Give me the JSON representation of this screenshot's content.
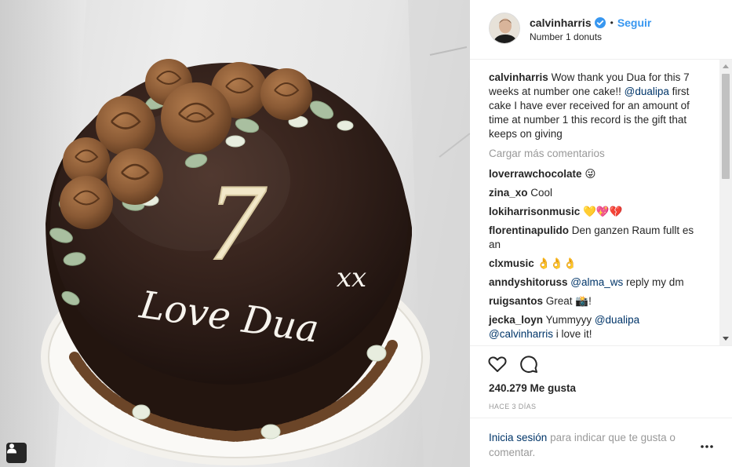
{
  "post": {
    "photo_alt": "Chocolate cake with seven piped chocolate roses, a large number 7 and the words Love Dua xx in white icing",
    "cake_text": {
      "number": "7",
      "message": "Love Dua",
      "kisses": "xx"
    }
  },
  "header": {
    "username": "calvinharris",
    "verified_icon": "verified-badge-icon",
    "separator": "•",
    "follow_label": "Seguir",
    "subtitle": "Number 1 donuts"
  },
  "caption": {
    "user": "calvinharris",
    "text_before": "Wow thank you Dua for this 7 weeks at number one cake!!",
    "mention": "@dualipa",
    "text_after": "first cake I have ever received for an amount of time at number 1 this record is the gift that keeps on giving"
  },
  "load_more_label": "Cargar más comentarios",
  "comments": [
    {
      "user": "loverrawchocolate",
      "text": "😜"
    },
    {
      "user": "zina_xo",
      "text": "Cool"
    },
    {
      "user": "lokiharrisonmusic",
      "text": "💛💖💔"
    },
    {
      "user": "florentinapulido",
      "text": "Den ganzen Raum fullt es an"
    },
    {
      "user": "clxmusic",
      "text": "👌👌👌"
    },
    {
      "user": "anndyshitoruss",
      "mention": "@alma_ws",
      "text": "reply my dm"
    },
    {
      "user": "ruigsantos",
      "text": "Great 📸!"
    },
    {
      "user": "jecka_loyn",
      "text": "Yummyyy",
      "mention": "@dualipa",
      "mention2": "@calvinharris",
      "text2": "i love it!"
    }
  ],
  "actions": {
    "like_icon": "heart-icon",
    "comment_icon": "comment-bubble-icon",
    "likes_label": "240.279 Me gusta",
    "time_label": "HACE 3 DÍAS"
  },
  "login": {
    "link": "Inicia sesión",
    "text": "para indicar que te gusta o comentar."
  },
  "colors": {
    "accent": "#3897f0",
    "link": "#003569",
    "muted": "#999999",
    "text": "#262626",
    "cake": "#2e1c17",
    "roses": "#8a5a35",
    "icing": "#f5efdc"
  }
}
